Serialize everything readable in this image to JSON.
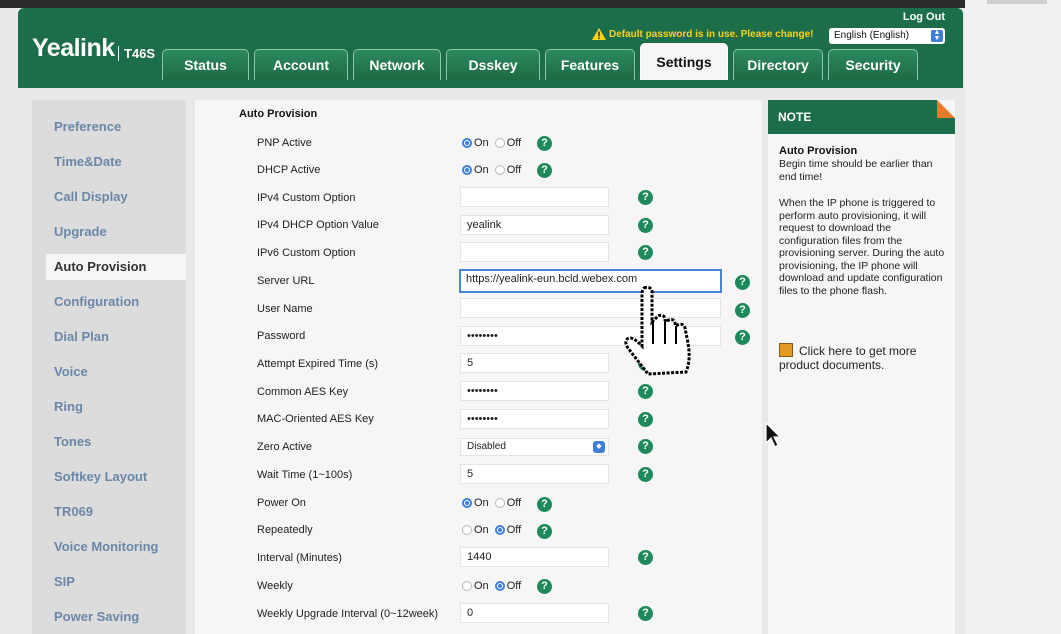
{
  "header": {
    "brand": "Yealink",
    "model": "T46S",
    "logout": "Log Out",
    "warning": "Default password is in use. Please change!",
    "language": "English (English)"
  },
  "tabs": [
    {
      "label": "Status"
    },
    {
      "label": "Account"
    },
    {
      "label": "Network"
    },
    {
      "label": "Dsskey"
    },
    {
      "label": "Features"
    },
    {
      "label": "Settings",
      "active": true
    },
    {
      "label": "Directory"
    },
    {
      "label": "Security"
    }
  ],
  "sidebar": {
    "items": [
      {
        "label": "Preference"
      },
      {
        "label": "Time&Date"
      },
      {
        "label": "Call Display"
      },
      {
        "label": "Upgrade"
      },
      {
        "label": "Auto Provision",
        "active": true
      },
      {
        "label": "Configuration"
      },
      {
        "label": "Dial Plan"
      },
      {
        "label": "Voice"
      },
      {
        "label": "Ring"
      },
      {
        "label": "Tones"
      },
      {
        "label": "Softkey Layout"
      },
      {
        "label": "TR069"
      },
      {
        "label": "Voice Monitoring"
      },
      {
        "label": "SIP"
      },
      {
        "label": "Power Saving"
      }
    ]
  },
  "form": {
    "title": "Auto Provision",
    "radio_on": "On",
    "radio_off": "Off",
    "rows": {
      "pnp_active": {
        "label": "PNP Active",
        "value": "On"
      },
      "dhcp_active": {
        "label": "DHCP Active",
        "value": "On"
      },
      "ipv4_custom_option": {
        "label": "IPv4 Custom Option",
        "value": ""
      },
      "ipv4_dhcp_option_value": {
        "label": "IPv4 DHCP Option Value",
        "value": "yealink"
      },
      "ipv6_custom_option": {
        "label": "IPv6 Custom Option",
        "value": ""
      },
      "server_url": {
        "label": "Server URL",
        "value": "https://yealink-eun.bcld.webex.com"
      },
      "user_name": {
        "label": "User Name",
        "value": ""
      },
      "password": {
        "label": "Password",
        "value": "••••••••"
      },
      "attempt_expired_time": {
        "label": "Attempt Expired Time (s)",
        "value": "5"
      },
      "common_aes_key": {
        "label": "Common AES Key",
        "value": "••••••••"
      },
      "mac_oriented_aes_key": {
        "label": "MAC-Oriented AES Key",
        "value": "••••••••"
      },
      "zero_active": {
        "label": "Zero Active",
        "value": "Disabled"
      },
      "wait_time": {
        "label": "Wait Time (1~100s)",
        "value": "5"
      },
      "power_on": {
        "label": "Power On",
        "value": "On"
      },
      "repeatedly": {
        "label": "Repeatedly",
        "value": "Off"
      },
      "interval": {
        "label": "Interval (Minutes)",
        "value": "1440"
      },
      "weekly": {
        "label": "Weekly",
        "value": "Off"
      },
      "weekly_upgrade_interval": {
        "label": "Weekly Upgrade Interval (0~12week)",
        "value": "0"
      }
    }
  },
  "note": {
    "header": "NOTE",
    "title": "Auto Provision",
    "line1": "Begin time should be earlier than end time!",
    "line2": "When the IP phone is triggered to perform auto provisioning, it will request to download the configuration files from the provisioning server. During the auto provisioning, the IP phone will download and update configuration files to the phone flash.",
    "link": "Click here to get more product documents."
  },
  "colors": {
    "brand_green": "#1c6e4a",
    "link_blue": "#6b87a8",
    "help_green": "#1e8a5b",
    "note_orange": "#e97a2c",
    "warning_yellow": "#ffd21a"
  }
}
